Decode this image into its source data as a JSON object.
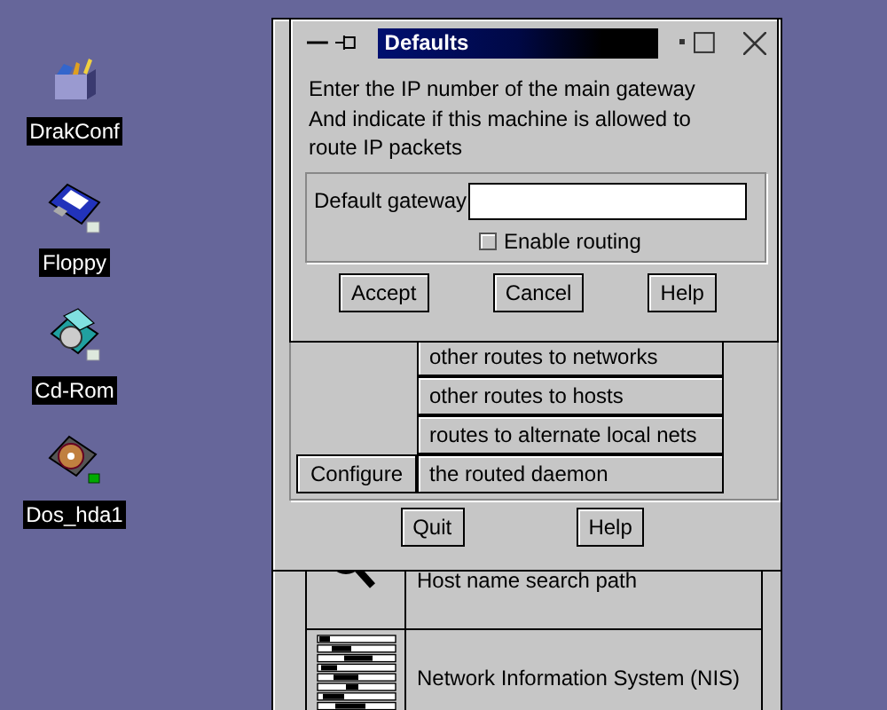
{
  "desktop_icons": [
    {
      "kind": "toolbox",
      "label": "DrakConf"
    },
    {
      "kind": "floppy",
      "label": "Floppy"
    },
    {
      "kind": "cdrom",
      "label": "Cd-Rom"
    },
    {
      "kind": "harddisk",
      "label": "Dos_hda1"
    }
  ],
  "back_window": {
    "rows": [
      {
        "kind": "search",
        "label": "Host name search path"
      },
      {
        "kind": "list",
        "label": "Network Information System (NIS)"
      }
    ]
  },
  "routing_window": {
    "route_buttons": [
      "other routes to networks",
      "other routes to hosts",
      "routes to alternate local nets",
      "the routed daemon"
    ],
    "configure_button": "Configure",
    "buttons": [
      "Quit",
      "Help"
    ]
  },
  "dialog": {
    "title": "Defaults",
    "lines": [
      "Enter the IP number of the main gateway",
      "And indicate if this machine is allowed to",
      "route IP packets"
    ],
    "gateway_label": "Default gateway",
    "routing_checkbox": {
      "label": "Enable routing",
      "checked": false
    },
    "buttons": [
      "Accept",
      "Cancel",
      "Help"
    ]
  }
}
